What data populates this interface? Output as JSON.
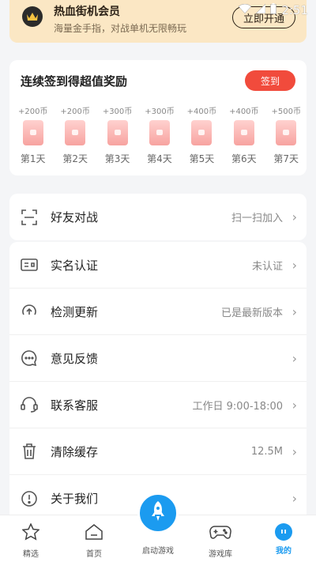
{
  "status_bar": {
    "time": "2:51"
  },
  "vip": {
    "title": "热血街机会员",
    "subtitle": "海量金手指，对战单机无限畅玩",
    "button": "立即开通"
  },
  "signin": {
    "title": "连续签到得超值奖励",
    "button": "签到",
    "days": [
      {
        "coins": "+200币",
        "label": "第1天"
      },
      {
        "coins": "+200币",
        "label": "第2天"
      },
      {
        "coins": "+300币",
        "label": "第3天"
      },
      {
        "coins": "+300币",
        "label": "第4天"
      },
      {
        "coins": "+400币",
        "label": "第5天"
      },
      {
        "coins": "+400币",
        "label": "第6天"
      },
      {
        "coins": "+500币",
        "label": "第7天"
      }
    ]
  },
  "menu": {
    "friend_battle": {
      "label": "好友对战",
      "value": "扫一扫加入"
    },
    "realname": {
      "label": "实名认证",
      "value": "未认证"
    },
    "update": {
      "label": "检测更新",
      "value": "已是最新版本"
    },
    "feedback": {
      "label": "意见反馈",
      "value": ""
    },
    "service": {
      "label": "联系客服",
      "value": "工作日 9:00-18:00"
    },
    "cache": {
      "label": "清除缓存",
      "value": "12.5M"
    },
    "about": {
      "label": "关于我们",
      "value": ""
    }
  },
  "nav": {
    "featured": "精选",
    "home": "首页",
    "launch": "启动游戏",
    "library": "游戏库",
    "mine": "我的"
  },
  "colors": {
    "accent": "#1b9bf0",
    "sign": "#f14b3c",
    "vip_bg": "#fbe7c4"
  }
}
